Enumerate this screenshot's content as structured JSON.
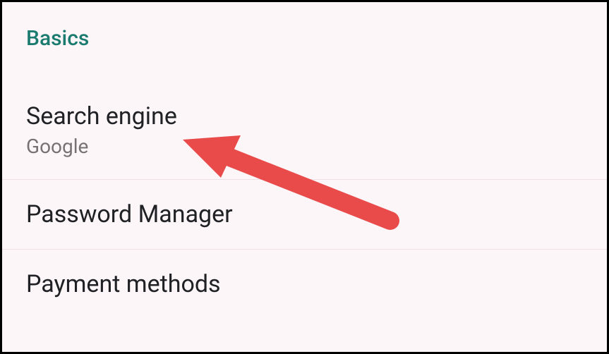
{
  "section": {
    "header": "Basics",
    "items": [
      {
        "title": "Search engine",
        "subtitle": "Google"
      },
      {
        "title": "Password Manager"
      },
      {
        "title": "Payment methods"
      }
    ]
  },
  "colors": {
    "accent": "#1a7b6e",
    "background": "#fdf6f9",
    "divider": "#f1dfe7",
    "textPrimary": "#202124",
    "textSecondary": "#767173",
    "annotation": "#e94b4b"
  }
}
